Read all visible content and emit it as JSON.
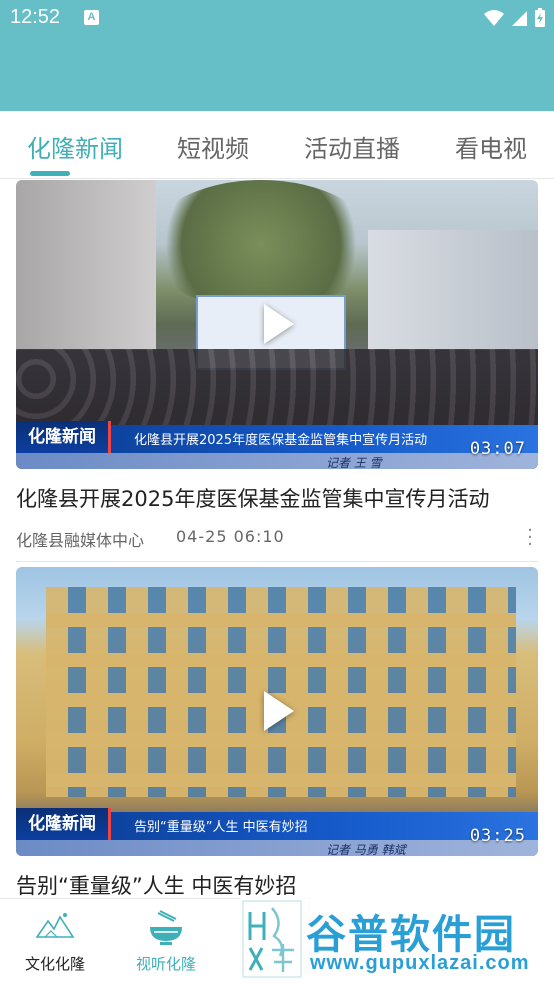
{
  "status_bar": {
    "time": "12:52",
    "notification_badge": "A"
  },
  "tabs": [
    {
      "label": "化隆新闻",
      "active": true
    },
    {
      "label": "短视频",
      "active": false
    },
    {
      "label": "活动直播",
      "active": false
    },
    {
      "label": "看电视",
      "active": false
    }
  ],
  "feed": [
    {
      "lower_third_logo": "化隆新闻",
      "lower_third_title": "化隆县开展2025年度医保基金监管集中宣传月活动",
      "lower_third_reporter": "记者  王 雪",
      "duration": "03:07",
      "title": "化隆县开展2025年度医保基金监管集中宣传月活动",
      "source": "化隆县融媒体中心",
      "time": "04-25  06:10"
    },
    {
      "lower_third_logo": "化隆新闻",
      "lower_third_title": "告别“重量级”人生 中医有妙招",
      "lower_third_reporter": "记者   马勇 韩斌",
      "duration": "03:25",
      "title": "告别“重量级”人生  中医有妙招"
    }
  ],
  "bottom_nav": [
    {
      "label": "文化化隆",
      "active": false
    },
    {
      "label": "视听化隆",
      "active": true
    }
  ],
  "watermark": {
    "brand": "谷普软件园",
    "url": "www.gupuxlazai.com"
  },
  "colors": {
    "header": "#66bfc6",
    "accent": "#3fb0b8"
  }
}
